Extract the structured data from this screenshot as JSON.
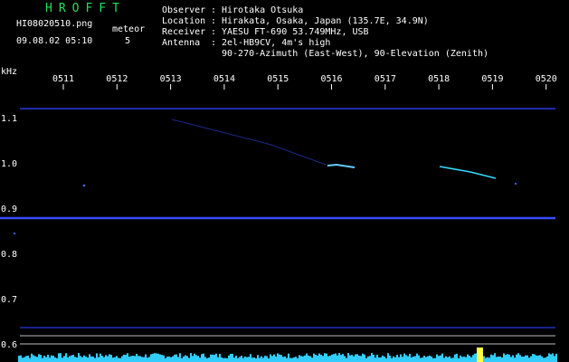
{
  "header": {
    "brand": "HROFFT",
    "filename": "HI08020510.png",
    "timestamp": "09.08.02 05:10",
    "meteor_label": "meteor",
    "meteor_count": "5"
  },
  "info": {
    "observer_label": "Observer",
    "observer": "Hirotaka Otsuka",
    "location_label": "Location",
    "location": "Hirakata, Osaka, Japan (135.7E, 34.9N)",
    "receiver_label": "Receiver",
    "receiver": "YAESU FT-690 53.749MHz, USB",
    "antenna_label": "Antenna",
    "antenna_line1": "2el-HB9CV, 4m's high",
    "antenna_line2": "90-270-Azimuth (East-West), 90-Elevation (Zenith)"
  },
  "axes": {
    "y_unit": "kHz",
    "y_ticks": [
      "1.1",
      "1.0",
      "0.9",
      "0.8",
      "0.7",
      "0.6"
    ],
    "x_ticks": [
      "0511",
      "0512",
      "0513",
      "0514",
      "0515",
      "0516",
      "0517",
      "0518",
      "0519",
      "0520"
    ]
  },
  "colors": {
    "background": "#000000",
    "text": "#ffffff",
    "brand": "#22e05a",
    "carrier": "#3344ff",
    "signal": "#33ddff",
    "spectrum": "#33ccff"
  }
}
